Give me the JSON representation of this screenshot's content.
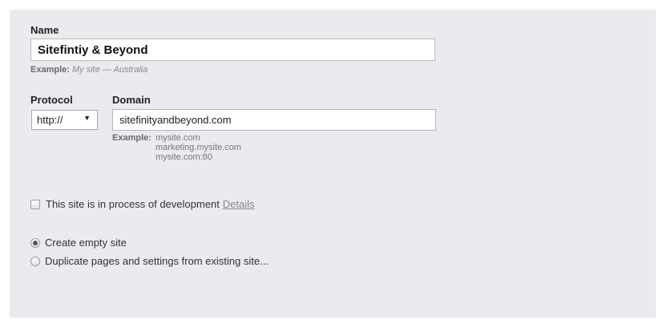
{
  "form": {
    "name_label": "Name",
    "name_value": "Sitefintiy & Beyond",
    "name_example_label": "Example:",
    "name_example_value": "My site — Australia",
    "protocol_label": "Protocol",
    "protocol_value": "http://",
    "domain_label": "Domain",
    "domain_value": "sitefinityandbeyond.com",
    "domain_example_label": "Example:",
    "domain_examples": [
      "mysite.com",
      "marketing.mysite.com",
      "mysite.com:80"
    ],
    "dev_checkbox_label": "This site is in process of development",
    "dev_checkbox_checked": false,
    "details_link": "Details",
    "radio_empty_label": "Create empty site",
    "radio_duplicate_label": "Duplicate pages and settings from existing site...",
    "selected_option": "empty"
  },
  "colors": {
    "panel_background": "#e9ebee",
    "input_border": "#b8b8b8",
    "hint_text": "#777777"
  }
}
